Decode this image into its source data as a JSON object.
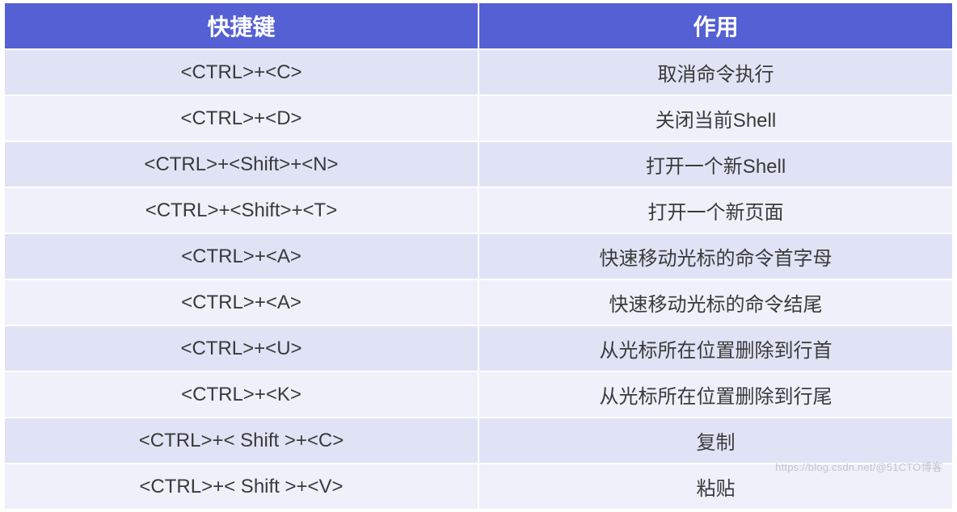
{
  "table": {
    "headers": {
      "shortcut": "快捷键",
      "action": "作用"
    },
    "rows": [
      {
        "shortcut": "<CTRL>+<C>",
        "action": "取消命令执行"
      },
      {
        "shortcut": "<CTRL>+<D>",
        "action": "关闭当前Shell"
      },
      {
        "shortcut": "<CTRL>+<Shift>+<N>",
        "action": "打开一个新Shell"
      },
      {
        "shortcut": "<CTRL>+<Shift>+<T>",
        "action": "打开一个新页面"
      },
      {
        "shortcut": "<CTRL>+<A>",
        "action": "快速移动光标的命令首字母"
      },
      {
        "shortcut": "<CTRL>+<A>",
        "action": "快速移动光标的命令结尾"
      },
      {
        "shortcut": "<CTRL>+<U>",
        "action": "从光标所在位置删除到行首"
      },
      {
        "shortcut": "<CTRL>+<K>",
        "action": "从光标所在位置删除到行尾"
      },
      {
        "shortcut": "<CTRL>+< Shift >+<C>",
        "action": "复制"
      },
      {
        "shortcut": "<CTRL>+< Shift >+<V>",
        "action": "粘贴"
      }
    ]
  },
  "watermark": "https://blog.csdn.net/@51CTO博客"
}
